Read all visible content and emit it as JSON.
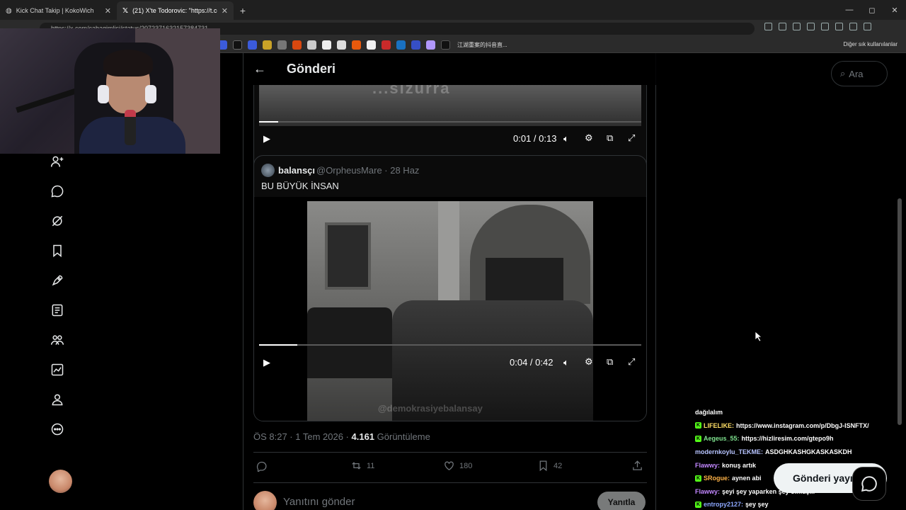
{
  "browser": {
    "tabs": [
      {
        "title": "Kick Chat Takip | KokoWich",
        "close": "✕"
      },
      {
        "title": "(21) X'te Todorovic: \"https://t.co/...\"",
        "close": "✕"
      }
    ],
    "new_tab": "+",
    "window_controls": [
      "—",
      "◻",
      "✕"
    ],
    "url": "https://x.com/cabagimlisi/status/2072371632157384731",
    "bookmark_label": "江湖重案的抖音直...",
    "other_bookmarks": "Diğer sık kullanılanlar"
  },
  "page": {
    "title": "Gönderi",
    "back": "←"
  },
  "video1": {
    "caption": "...sizurra",
    "time": "0:01 / 0:13",
    "progress": 0.05
  },
  "quoted": {
    "name": "balansçı",
    "handle_date": "@OrpheusMare · 28 Haz",
    "text": "BU BÜYÜK İNSAN",
    "watermark": "@demokrasiyebalansay",
    "time": "0:04 / 0:42",
    "progress": 0.1
  },
  "meta": {
    "time_date": "ÖS 8:27 · 1 Tem 2026 · ",
    "views_count": "4.161",
    "views_label": " Görüntüleme"
  },
  "actions": {
    "reposts": "11",
    "likes": "180",
    "bookmarks": "42"
  },
  "reply": {
    "placeholder": "Yanıtını gönder",
    "button": "Yanıtla"
  },
  "right": {
    "search_placeholder": "Ara",
    "post_button": "Gönderi yayınla"
  },
  "chat": [
    {
      "badge": "",
      "user": "",
      "user_color": "#ffffff",
      "msg": "dağılalım"
    },
    {
      "badge": "K",
      "user": "LIFELIKE:",
      "user_color": "#ffe066",
      "msg": "https://www.instagram.com/p/DbgJ-ISNFTX/"
    },
    {
      "badge": "K",
      "user": "Aegeus_55:",
      "user_color": "#7fe38f",
      "msg": "https://hizliresim.com/gtepo9h"
    },
    {
      "badge": "",
      "user": "modernkoylu_TEKME:",
      "user_color": "#b7c4ff",
      "msg": "ASDGHKASHGKASKASKDH"
    },
    {
      "badge": "",
      "user": "Flawwy:",
      "user_color": "#c287ff",
      "msg": "konuş artık"
    },
    {
      "badge": "K",
      "user": "SRogue:",
      "user_color": "#ffb347",
      "msg": "aynen abi"
    },
    {
      "badge": "",
      "user": "Flawwy:",
      "user_color": "#c287ff",
      "msg": "şeyi şey yaparken şey olmuş..."
    },
    {
      "badge": "K",
      "user": "entropy2127:",
      "user_color": "#8da8ff",
      "msg": "şey şey"
    }
  ]
}
